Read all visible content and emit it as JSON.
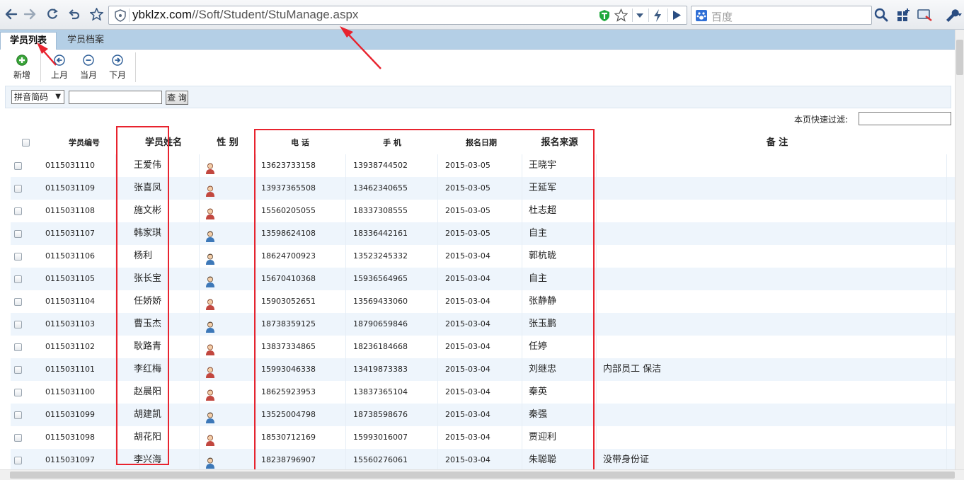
{
  "browser": {
    "url_host": "ybklzx.com",
    "url_path": "//Soft/Student/StuManage.aspx",
    "search_placeholder": "百度"
  },
  "tabs": [
    {
      "label": "学员列表",
      "active": true
    },
    {
      "label": "学员档案",
      "active": false
    }
  ],
  "actions": {
    "add": "新增",
    "prev_month": "上月",
    "this_month": "当月",
    "next_month": "下月"
  },
  "search": {
    "field_selected": "拼音简码",
    "query_button": "查 询",
    "quick_filter_label": "本页快速过滤:"
  },
  "columns": {
    "id": "学员编号",
    "name": "学员姓名",
    "sex": "性 别",
    "tel": "电 话",
    "mobile": "手 机",
    "date": "报名日期",
    "source": "报名来源",
    "note": "备 注"
  },
  "rows": [
    {
      "id": "0115031110",
      "name": "王爱伟",
      "sex": "female",
      "tel": "13623733158",
      "mobile": "13938744502",
      "date": "2015-03-05",
      "source": "王晓宇",
      "note": ""
    },
    {
      "id": "0115031109",
      "name": "张喜凤",
      "sex": "female",
      "tel": "13937365508",
      "mobile": "13462340655",
      "date": "2015-03-05",
      "source": "王延军",
      "note": ""
    },
    {
      "id": "0115031108",
      "name": "施文彬",
      "sex": "female",
      "tel": "15560205055",
      "mobile": "18337308555",
      "date": "2015-03-05",
      "source": "杜志超",
      "note": ""
    },
    {
      "id": "0115031107",
      "name": "韩家琪",
      "sex": "male",
      "tel": "13598624108",
      "mobile": "18336442161",
      "date": "2015-03-05",
      "source": "自主",
      "note": ""
    },
    {
      "id": "0115031106",
      "name": "杨利",
      "sex": "male",
      "tel": "18624700923",
      "mobile": "13523245332",
      "date": "2015-03-04",
      "source": "郭杭昽",
      "note": ""
    },
    {
      "id": "0115031105",
      "name": "张长宝",
      "sex": "male",
      "tel": "15670410368",
      "mobile": "15936564965",
      "date": "2015-03-04",
      "source": "自主",
      "note": ""
    },
    {
      "id": "0115031104",
      "name": "任娇娇",
      "sex": "female",
      "tel": "15903052651",
      "mobile": "13569433060",
      "date": "2015-03-04",
      "source": "张静静",
      "note": ""
    },
    {
      "id": "0115031103",
      "name": "曹玉杰",
      "sex": "male",
      "tel": "18738359125",
      "mobile": "18790659846",
      "date": "2015-03-04",
      "source": "张玉鹏",
      "note": ""
    },
    {
      "id": "0115031102",
      "name": "耿路青",
      "sex": "female",
      "tel": "13837334865",
      "mobile": "18236184668",
      "date": "2015-03-04",
      "source": "任婷",
      "note": ""
    },
    {
      "id": "0115031101",
      "name": "李红梅",
      "sex": "female",
      "tel": "15993046338",
      "mobile": "13419873383",
      "date": "2015-03-04",
      "source": "刘继忠",
      "note": "内部员工 保洁"
    },
    {
      "id": "0115031100",
      "name": "赵晨阳",
      "sex": "female",
      "tel": "18625923953",
      "mobile": "13837365104",
      "date": "2015-03-04",
      "source": "秦英",
      "note": ""
    },
    {
      "id": "0115031099",
      "name": "胡建凯",
      "sex": "male",
      "tel": "13525004798",
      "mobile": "18738598676",
      "date": "2015-03-04",
      "source": "秦强",
      "note": ""
    },
    {
      "id": "0115031098",
      "name": "胡花阳",
      "sex": "female",
      "tel": "18530712169",
      "mobile": "15993016007",
      "date": "2015-03-04",
      "source": "贾迎利",
      "note": ""
    },
    {
      "id": "0115031097",
      "name": "李兴海",
      "sex": "male",
      "tel": "18238796907",
      "mobile": "15560276061",
      "date": "2015-03-04",
      "source": "朱聪聪",
      "note": "没带身份证"
    }
  ],
  "colors": {
    "tabbar": "#b4cfe6",
    "alt_row": "#eef5fc",
    "annotation": "#e8232e",
    "female_icon": "#c2473f",
    "male_icon": "#3d78b8"
  }
}
